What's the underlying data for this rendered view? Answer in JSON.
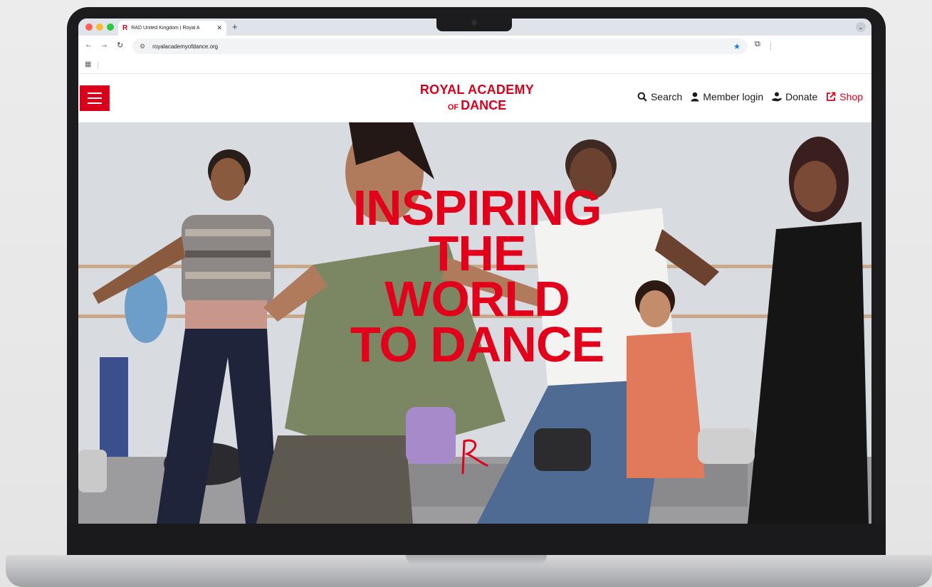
{
  "browser": {
    "tab_title": "RAD United Kingdom | Royal A",
    "tab_favicon": "R",
    "new_tab_symbol": "+",
    "close_symbol": "✕",
    "url": "royalacademyofdance.org"
  },
  "site": {
    "logo_line1": "ROYAL ACADEMY",
    "logo_of": "OF",
    "logo_line2": "DANCE",
    "nav": {
      "search": "Search",
      "member_login": "Member login",
      "donate": "Donate",
      "shop": "Shop"
    }
  },
  "hero": {
    "heading_lines": [
      "INSPIRING",
      "THE",
      "WORLD",
      "TO DANCE"
    ]
  },
  "colors": {
    "brand_red": "#d9001b",
    "hero_text_red": "#e3001b"
  },
  "icons": [
    "menu-icon",
    "search-icon",
    "user-icon",
    "donate-icon",
    "external-link-icon",
    "star-icon",
    "apps-icon",
    "extensions-icon"
  ]
}
